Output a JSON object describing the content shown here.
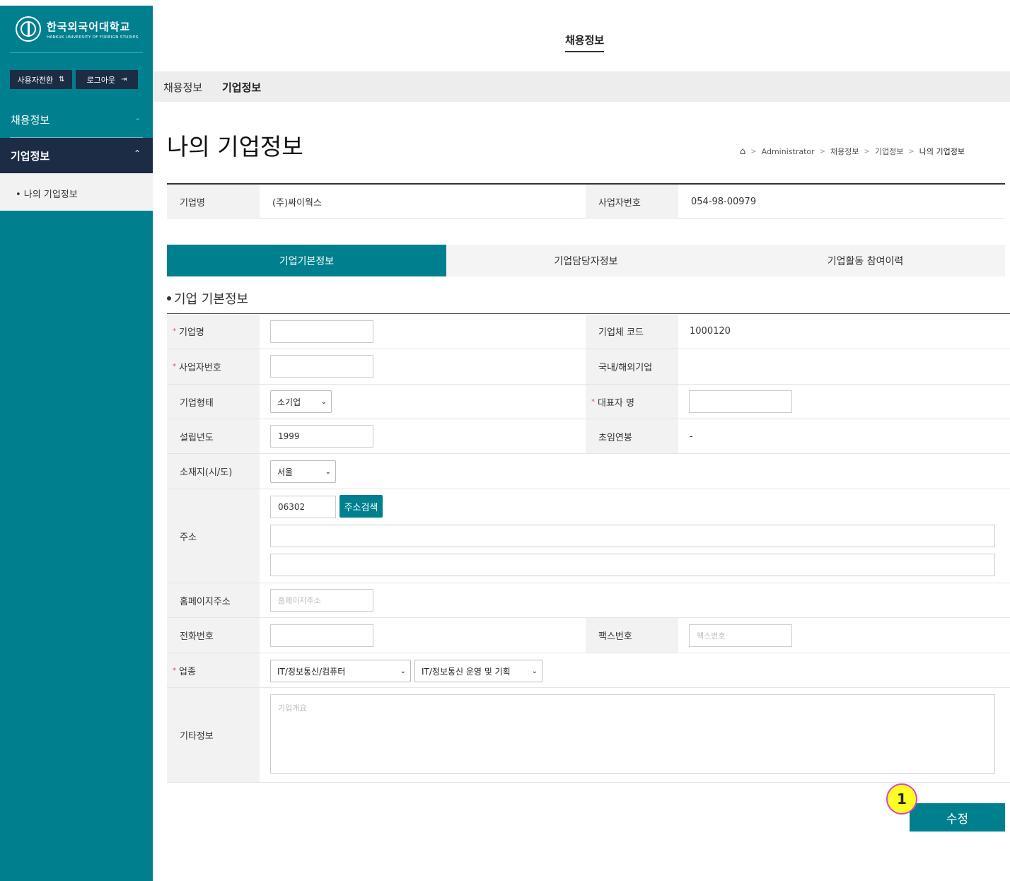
{
  "sidebar": {
    "logo_ko": "한국외국어대학교",
    "logo_en": "HANKUK UNIVERSITY OF FOREIGN STUDIES",
    "switch_user_label": "사용자전환",
    "logout_label": "로그아웃",
    "menu_recruit": "채용정보",
    "menu_company": "기업정보",
    "submenu_item": "• 나의 기업정보"
  },
  "header": {
    "title": "채용정보",
    "gnb": [
      "채용정보",
      "기업정보"
    ]
  },
  "page": {
    "title": "나의 기업정보",
    "breadcrumb": [
      "Administrator",
      "채용정보",
      "기업정보",
      "나의 기업정보"
    ]
  },
  "summary": {
    "company_label": "기업명",
    "company_value": "(주)싸이웍스",
    "bizno_label": "사업자번호",
    "bizno_value": "054-98-00979"
  },
  "tabs": [
    "기업기본정보",
    "기업담당자정보",
    "기업활동 참여이력"
  ],
  "section_title": "기업 기본정보",
  "form": {
    "company_name_label": "기업명",
    "company_name_value": "",
    "company_code_label": "기업체 코드",
    "company_code_value": "1000120",
    "bizno_label": "사업자번호",
    "bizno_value": "",
    "domestic_label": "국내/해외기업",
    "type_label": "기업형태",
    "type_value": "소기업",
    "ceo_label": "대표자 명",
    "ceo_value": "",
    "founded_label": "설립년도",
    "founded_value": "1999",
    "salary_label": "초임연봉",
    "salary_value": "-",
    "region_label": "소재지(시/도)",
    "region_value": "서울",
    "address_label": "주소",
    "zip_value": "06302",
    "address_search_label": "주소검색",
    "homepage_label": "홈페이지주소",
    "homepage_placeholder": "홈페이지주소",
    "phone_label": "전화번호",
    "fax_label": "팩스번호",
    "fax_placeholder": "팩스번호",
    "industry_label": "업종",
    "industry_value1": "IT/정보통신/컴퓨터",
    "industry_value2": "IT/정보통신 운영 및 기획",
    "etc_label": "기타정보",
    "etc_placeholder": "기업개요"
  },
  "save_label": "수정",
  "marker_label": "1",
  "colors": {
    "teal": "#00808f",
    "navy": "#1c2c44",
    "required": "#d9534f",
    "marker": "#ffff22"
  }
}
